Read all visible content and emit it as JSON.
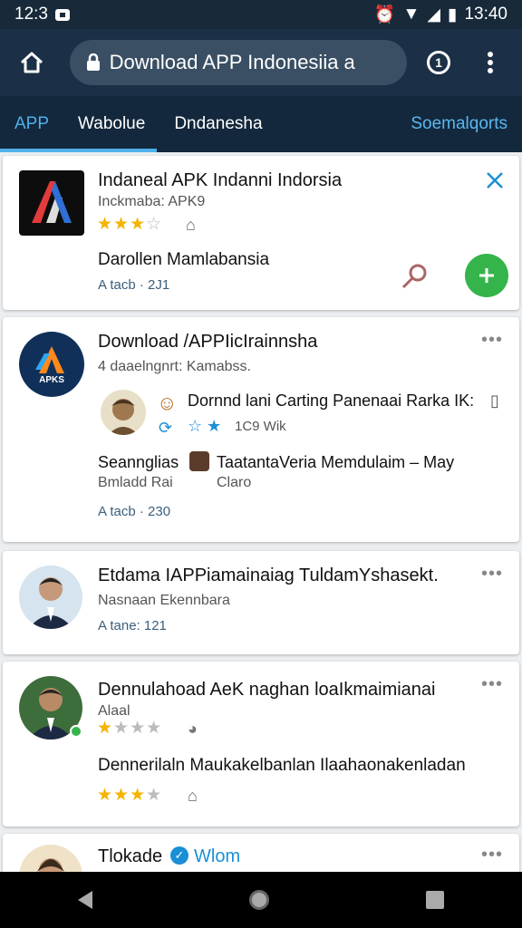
{
  "status": {
    "time_left": "12:3",
    "time_right": "13:40"
  },
  "toolbar": {
    "url": "Download APP Indonesiia a",
    "tab_count": "1"
  },
  "tabs": [
    {
      "label": "APP"
    },
    {
      "label": "Wabolue"
    },
    {
      "label": "Dndanesha"
    },
    {
      "label": "Soemalqorts"
    }
  ],
  "cards": [
    {
      "title": "Indaneal APK Indanni Indorsia",
      "subtitle": "Inckmaba: APK9",
      "rating": 3,
      "description": "Darollen Mamlabansia",
      "meta": "A tacb · 2J1",
      "colors": {
        "install_button": "#34b44a"
      }
    },
    {
      "title": "Download /APPIicIrainnsha",
      "subtitle": "4 daaelngnrt: Kamabss.",
      "icon_label": "APKS",
      "sub_item_title": "Dornnd lani Carting Panenaai Rarka IK:",
      "sub_item_meta": "1C9 Wik",
      "extra_left_1": "Seannglias",
      "extra_left_2": "Bmladd Rai",
      "extra_right_1": "TaatantaVeria Memdulaim – May",
      "extra_right_2": "Claro",
      "meta": "A tacb · 230"
    },
    {
      "title": "Etdama IAPPiamainaiag TuldamYshasekt.",
      "subtitle": "Nasnaan Ekennbara",
      "meta": "A tane: 121"
    },
    {
      "title": "Dennulahoad AeK naghan loaIkmaimianai",
      "subtitle": "Alaal",
      "rating": 1,
      "description": "Dennerilaln Maukakelbanlan Ilaahaonakenladan",
      "rating2": 3
    },
    {
      "title": "Tlokade",
      "verified_label": "Wlom"
    }
  ]
}
